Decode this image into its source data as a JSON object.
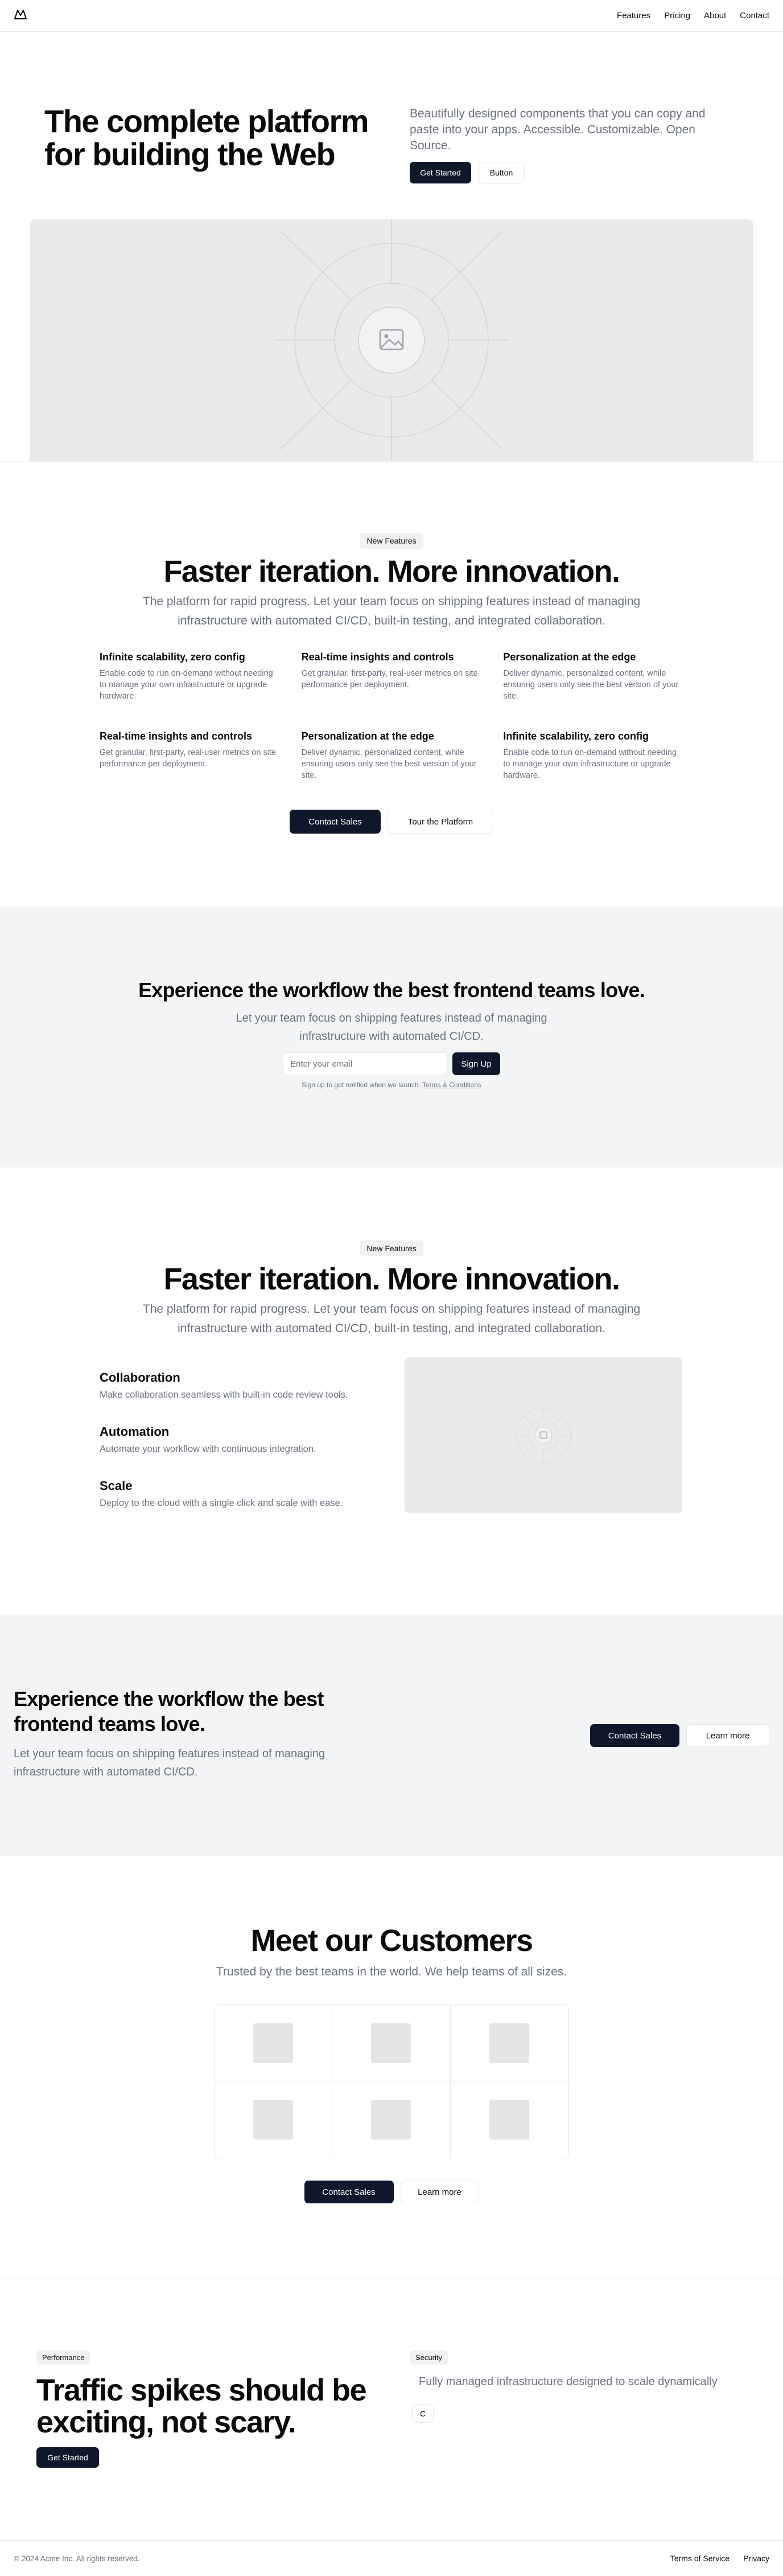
{
  "header": {
    "nav": [
      "Features",
      "Pricing",
      "About",
      "Contact"
    ]
  },
  "hero": {
    "title": "The complete platform for building the Web",
    "description": "Beautifully designed components that you can copy and paste into your apps. Accessible. Customizable. Open Source.",
    "primary_button": "Get Started",
    "secondary_button": "Button"
  },
  "features": {
    "badge": "New Features",
    "title": "Faster iteration. More innovation.",
    "lead": "The platform for rapid progress. Let your team focus on shipping features instead of managing infrastructure with automated CI/CD, built-in testing, and integrated collaboration.",
    "items": [
      {
        "title": "Infinite scalability, zero config",
        "text": "Enable code to run on-demand without needing to manage your own infrastructure or upgrade hardware."
      },
      {
        "title": "Real-time insights and controls",
        "text": "Get granular, first-party, real-user metrics on site performance per deployment."
      },
      {
        "title": "Personalization at the edge",
        "text": "Deliver dynamic, personalized content, while ensuring users only see the best version of your site."
      },
      {
        "title": "Real-time insights and controls",
        "text": "Get granular, first-party, real-user metrics on site performance per deployment."
      },
      {
        "title": "Personalization at the edge",
        "text": "Deliver dynamic, personalized content, while ensuring users only see the best version of your site."
      },
      {
        "title": "Infinite scalability, zero config",
        "text": "Enable code to run on-demand without needing to manage your own infrastructure or upgrade hardware."
      }
    ],
    "primary_button": "Contact Sales",
    "secondary_button": "Tour the Platform"
  },
  "signup": {
    "title": "Experience the workflow the best frontend teams love.",
    "lead": "Let your team focus on shipping features instead of managing infrastructure with automated CI/CD.",
    "email_placeholder": "Enter your email",
    "button": "Sign Up",
    "note_prefix": "Sign up to get notified when we launch.",
    "note_link": "Terms & Conditions"
  },
  "features2": {
    "badge": "New Features",
    "title": "Faster iteration. More innovation.",
    "lead": "The platform for rapid progress. Let your team focus on shipping features instead of managing infrastructure with automated CI/CD, built-in testing, and integrated collaboration.",
    "items": [
      {
        "title": "Collaboration",
        "text": "Make collaboration seamless with built-in code review tools."
      },
      {
        "title": "Automation",
        "text": "Automate your workflow with continuous integration."
      },
      {
        "title": "Scale",
        "text": "Deploy to the cloud with a single click and scale with ease."
      }
    ]
  },
  "cta": {
    "title": "Experience the workflow the best frontend teams love.",
    "lead": "Let your team focus on shipping features instead of managing infrastructure with automated CI/CD.",
    "primary_button": "Contact Sales",
    "secondary_button": "Learn more"
  },
  "customers": {
    "title": "Meet our Customers",
    "lead": "Trusted by the best teams in the world. We help teams of all sizes.",
    "primary_button": "Contact Sales",
    "secondary_button": "Learn more"
  },
  "traffic": {
    "badge_left": "Performance",
    "title": "Traffic spikes should be exciting, not scary.",
    "button": "Get Started",
    "badge_right": "Security",
    "text": "Fully managed infrastructure designed to scale dynamically",
    "small_button": "C"
  },
  "footer": {
    "copyright": "© 2024 Acme Inc. All rights reserved.",
    "links": [
      "Terms of Service",
      "Privacy"
    ]
  }
}
